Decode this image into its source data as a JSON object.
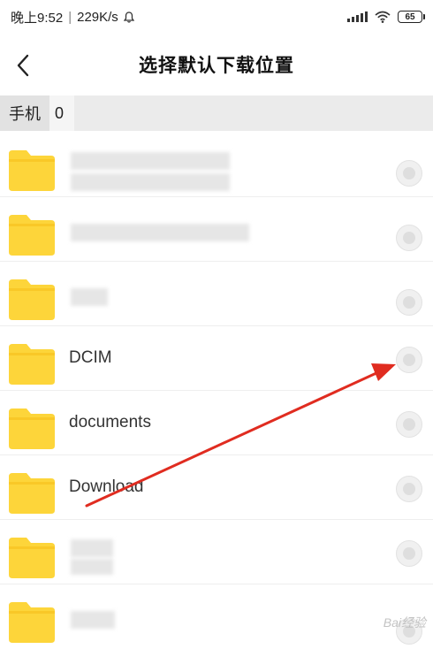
{
  "status_bar": {
    "time": "晚上9:52",
    "separator": "|",
    "network_speed": "229K/s",
    "notification_icon": "bell-icon",
    "signal_icon": "signal-icon",
    "wifi_icon": "wifi-icon",
    "battery_level": "65"
  },
  "header": {
    "back_icon": "chevron-left-icon",
    "title": "选择默认下载位置"
  },
  "breadcrumb": {
    "root": "手机",
    "count": "0"
  },
  "folders": [
    {
      "name": "",
      "blurred": true
    },
    {
      "name": "",
      "blurred": true
    },
    {
      "name": "",
      "blurred": true
    },
    {
      "name": "DCIM",
      "blurred": false
    },
    {
      "name": "documents",
      "blurred": false
    },
    {
      "name": "Download",
      "blurred": false
    },
    {
      "name": "",
      "blurred": true
    },
    {
      "name": "",
      "blurred": true
    }
  ],
  "colors": {
    "folder": "#FDD53A",
    "folder_tab": "#F9C827",
    "arrow": "#E02C20"
  },
  "watermark": "Bai经验"
}
